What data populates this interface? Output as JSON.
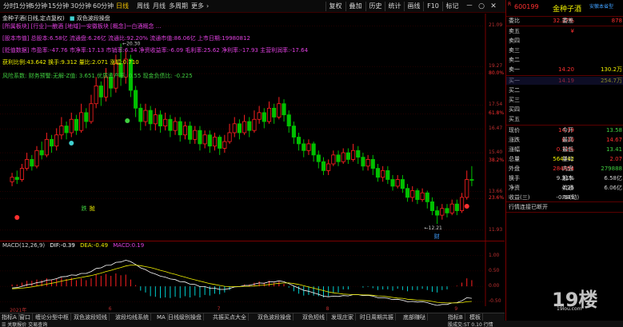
{
  "toolbar": {
    "periods": [
      "分时",
      "1分钟",
      "5分钟",
      "15分钟",
      "30分钟",
      "60分钟",
      "日线",
      "周线",
      "月线",
      "多周期",
      "更多"
    ],
    "active_period": "日线",
    "more_arrow": "›",
    "buttons": [
      "复权",
      "叠加",
      "历史",
      "统计",
      "画线",
      "F10",
      "标记"
    ],
    "window_controls": [
      "－",
      "○",
      "✕"
    ]
  },
  "main_chart": {
    "title": "金种子酒(日线,定点复权)",
    "indicator_name": "双色波段操盘",
    "info_lines": [
      {
        "text": "[所属板块]  [行业]一酿酒  [地域]一安徽板块  [概念]一白酒概念  ...",
        "color": "#e040e0"
      },
      {
        "text": "[股本市值]  总股本:6.58亿  流通盘:6.26亿  流通比:92.20%  流通市值:86.06亿  上市日期:19980812",
        "color": "#e040e0"
      },
      {
        "text": "[贬值数据]  市盈率:-47.76  市净率:17.13  市销率:6.34  净资收益率:-6.09  毛利率:25.62  净利率:-17.93  主营利润率:-17.64",
        "color": "#e040e0"
      },
      {
        "text": "获利比例:43.642    换手:9.312      量比:2.071      涨幅:0.710",
        "color": "#f0f000"
      },
      {
        "text": "风险系数: 财务预警:无解-Z值: 3.651  优质资产率: 0.55  现金负债比: -0.225",
        "color": "#40d040"
      }
    ],
    "high_label": "20.30",
    "low_label": "12.21",
    "bottom_badge_left": "跌",
    "bottom_badge_right": "抛",
    "low_badge": "财",
    "price_ticks": [
      {
        "label": "21.09",
        "price": 21.09
      },
      {
        "label": "19.27",
        "price": 19.27
      },
      {
        "label": "80.0%",
        "price": 18.95
      },
      {
        "label": "17.54",
        "price": 17.54
      },
      {
        "label": "61.8%",
        "price": 17.15
      },
      {
        "label": "16.47",
        "price": 16.47
      },
      {
        "label": "15.40",
        "price": 15.4
      },
      {
        "label": "38.2%",
        "price": 15.05
      },
      {
        "label": "13.66",
        "price": 13.66
      },
      {
        "label": "23.6%",
        "price": 13.35
      },
      {
        "label": "11.93",
        "price": 11.93
      }
    ],
    "price_range": [
      11.6,
      21.5
    ]
  },
  "candles": [
    [
      14.1,
      14.3,
      14.5,
      13.9
    ],
    [
      14.3,
      14.2,
      14.6,
      14.0
    ],
    [
      14.2,
      14.7,
      14.9,
      14.1
    ],
    [
      14.7,
      15.1,
      15.4,
      14.6
    ],
    [
      15.1,
      14.8,
      15.3,
      14.6
    ],
    [
      14.8,
      15.5,
      15.7,
      14.7
    ],
    [
      15.5,
      15.3,
      15.9,
      15.1
    ],
    [
      15.3,
      16.0,
      16.3,
      15.2
    ],
    [
      16.0,
      15.7,
      16.2,
      15.4
    ],
    [
      15.7,
      16.2,
      16.5,
      15.5
    ],
    [
      16.2,
      16.6,
      17.0,
      16.0
    ],
    [
      16.6,
      16.3,
      16.8,
      16.0
    ],
    [
      16.3,
      16.9,
      17.2,
      16.1
    ],
    [
      16.9,
      16.4,
      17.1,
      16.2
    ],
    [
      16.4,
      17.2,
      17.6,
      16.3
    ],
    [
      17.2,
      16.8,
      17.4,
      16.5
    ],
    [
      16.8,
      17.6,
      18.0,
      16.7
    ],
    [
      17.6,
      18.4,
      18.8,
      17.4
    ],
    [
      18.4,
      17.9,
      18.6,
      17.5
    ],
    [
      17.9,
      18.8,
      19.2,
      17.7
    ],
    [
      18.8,
      18.3,
      19.0,
      17.9
    ],
    [
      18.3,
      19.4,
      19.8,
      18.1
    ],
    [
      19.4,
      18.8,
      20.3,
      18.4
    ],
    [
      18.8,
      19.6,
      20.0,
      18.5
    ],
    [
      19.6,
      18.2,
      19.8,
      17.9
    ],
    [
      18.2,
      17.4,
      18.4,
      17.0
    ],
    [
      17.4,
      16.8,
      17.6,
      16.4
    ],
    [
      16.8,
      17.3,
      17.6,
      16.6
    ],
    [
      17.3,
      16.7,
      17.5,
      16.4
    ],
    [
      16.7,
      17.1,
      17.4,
      16.4
    ],
    [
      17.1,
      16.6,
      17.3,
      16.3
    ],
    [
      16.6,
      16.9,
      17.2,
      16.4
    ],
    [
      16.9,
      16.4,
      17.1,
      16.1
    ],
    [
      16.4,
      16.8,
      17.0,
      16.2
    ],
    [
      16.8,
      16.2,
      17.0,
      15.9
    ],
    [
      16.2,
      16.6,
      16.8,
      16.0
    ],
    [
      16.6,
      16.0,
      16.8,
      15.8
    ],
    [
      16.0,
      16.4,
      16.6,
      15.8
    ],
    [
      16.4,
      15.8,
      16.6,
      15.5
    ],
    [
      15.8,
      16.2,
      16.4,
      15.6
    ],
    [
      16.2,
      15.7,
      16.4,
      15.4
    ],
    [
      15.7,
      16.1,
      16.3,
      15.5
    ],
    [
      16.1,
      15.6,
      16.2,
      15.3
    ],
    [
      15.6,
      15.9,
      16.2,
      15.4
    ],
    [
      15.9,
      16.3,
      16.7,
      15.8
    ],
    [
      16.3,
      16.7,
      17.0,
      16.1
    ],
    [
      16.7,
      16.3,
      16.9,
      16.0
    ],
    [
      16.3,
      16.8,
      17.1,
      16.2
    ],
    [
      16.8,
      16.4,
      17.0,
      16.1
    ],
    [
      16.4,
      16.9,
      17.3,
      16.3
    ],
    [
      16.9,
      17.2,
      17.5,
      16.7
    ],
    [
      17.2,
      16.8,
      17.4,
      16.5
    ],
    [
      16.8,
      17.4,
      17.7,
      16.7
    ],
    [
      17.4,
      17.0,
      17.6,
      16.7
    ],
    [
      17.0,
      17.6,
      17.9,
      16.9
    ],
    [
      17.6,
      17.1,
      17.8,
      16.8
    ],
    [
      17.1,
      16.6,
      17.3,
      16.3
    ],
    [
      16.6,
      16.1,
      16.8,
      15.8
    ],
    [
      16.1,
      15.8,
      16.3,
      15.5
    ],
    [
      15.8,
      15.5,
      16.0,
      15.2
    ],
    [
      15.5,
      15.8,
      16.0,
      15.3
    ],
    [
      15.8,
      15.3,
      15.9,
      15.0
    ],
    [
      15.3,
      15.0,
      15.5,
      14.7
    ],
    [
      15.0,
      14.6,
      15.2,
      14.4
    ],
    [
      14.6,
      14.9,
      15.1,
      14.4
    ],
    [
      14.9,
      15.3,
      15.5,
      14.8
    ],
    [
      15.3,
      15.0,
      15.5,
      14.8
    ],
    [
      15.0,
      15.4,
      15.6,
      14.9
    ],
    [
      15.4,
      15.1,
      15.6,
      14.9
    ],
    [
      15.1,
      15.5,
      15.8,
      15.0
    ],
    [
      15.5,
      15.2,
      15.7,
      14.9
    ],
    [
      15.2,
      14.8,
      15.4,
      14.6
    ],
    [
      14.8,
      15.1,
      15.3,
      14.6
    ],
    [
      15.1,
      14.7,
      15.3,
      14.4
    ],
    [
      14.7,
      14.3,
      14.9,
      14.1
    ],
    [
      14.3,
      14.6,
      14.8,
      14.1
    ],
    [
      14.6,
      14.2,
      14.8,
      14.0
    ],
    [
      14.2,
      13.9,
      14.4,
      13.7
    ],
    [
      13.9,
      14.2,
      14.4,
      13.8
    ],
    [
      14.2,
      13.8,
      14.4,
      13.6
    ],
    [
      13.8,
      13.4,
      14.0,
      13.2
    ],
    [
      13.4,
      13.7,
      13.9,
      13.2
    ],
    [
      13.7,
      13.3,
      13.8,
      13.1
    ],
    [
      13.3,
      13.6,
      13.8,
      13.2
    ],
    [
      13.6,
      13.2,
      13.7,
      12.9
    ],
    [
      13.2,
      12.8,
      13.4,
      12.6
    ],
    [
      12.8,
      12.6,
      13.0,
      12.21
    ],
    [
      12.6,
      12.9,
      13.1,
      12.4
    ],
    [
      12.9,
      12.7,
      13.1,
      12.5
    ],
    [
      12.7,
      13.1,
      13.3,
      12.6
    ],
    [
      13.1,
      12.8,
      13.3,
      12.6
    ],
    [
      12.8,
      13.4,
      13.6,
      12.7
    ],
    [
      13.4,
      14.2,
      14.6,
      13.3
    ],
    [
      14.2,
      14.19,
      14.8,
      13.9
    ]
  ],
  "macd": {
    "label": "MACD(12,26,9)",
    "dif": "-0.39",
    "dea": "-0.49",
    "macd": "0.19",
    "dif_prefix": "DIF:",
    "dea_prefix": "DEA:",
    "macd_prefix": "MACD:",
    "range": [
      -0.62,
      1.25
    ],
    "ticks": [
      {
        "label": "1.00",
        "v": 1.0
      },
      {
        "label": "0.50",
        "v": 0.5
      },
      {
        "label": "0.00",
        "v": 0.0
      },
      {
        "label": "-0.50",
        "v": -0.5
      }
    ],
    "dif_series": [
      -0.05,
      -0.04,
      0.0,
      0.05,
      0.07,
      0.12,
      0.14,
      0.2,
      0.21,
      0.25,
      0.31,
      0.32,
      0.37,
      0.36,
      0.42,
      0.42,
      0.48,
      0.58,
      0.6,
      0.68,
      0.69,
      0.78,
      0.79,
      0.85,
      0.8,
      0.71,
      0.6,
      0.54,
      0.45,
      0.4,
      0.33,
      0.3,
      0.24,
      0.22,
      0.15,
      0.14,
      0.07,
      0.06,
      -0.01,
      -0.01,
      -0.06,
      -0.06,
      -0.1,
      -0.1,
      -0.07,
      -0.02,
      -0.01,
      0.03,
      0.03,
      0.07,
      0.11,
      0.1,
      0.15,
      0.14,
      0.18,
      0.15,
      0.09,
      0.01,
      -0.06,
      -0.13,
      -0.16,
      -0.21,
      -0.26,
      -0.32,
      -0.34,
      -0.32,
      -0.33,
      -0.3,
      -0.31,
      -0.27,
      -0.27,
      -0.3,
      -0.29,
      -0.32,
      -0.37,
      -0.37,
      -0.39,
      -0.43,
      -0.42,
      -0.45,
      -0.5,
      -0.49,
      -0.51,
      -0.5,
      -0.53,
      -0.58,
      -0.62,
      -0.59,
      -0.59,
      -0.54,
      -0.53,
      -0.47,
      -0.37,
      -0.39
    ],
    "dea_series": [
      -0.08,
      -0.07,
      -0.06,
      -0.04,
      -0.02,
      0.01,
      0.04,
      0.07,
      0.1,
      0.13,
      0.17,
      0.2,
      0.23,
      0.26,
      0.29,
      0.32,
      0.35,
      0.39,
      0.43,
      0.48,
      0.52,
      0.57,
      0.61,
      0.66,
      0.69,
      0.69,
      0.67,
      0.64,
      0.61,
      0.57,
      0.52,
      0.48,
      0.43,
      0.39,
      0.34,
      0.3,
      0.25,
      0.21,
      0.17,
      0.13,
      0.09,
      0.06,
      0.03,
      0.0,
      -0.01,
      -0.01,
      -0.01,
      0.0,
      0.0,
      0.01,
      0.03,
      0.04,
      0.06,
      0.08,
      0.1,
      0.11,
      0.11,
      0.09,
      0.06,
      0.02,
      -0.02,
      -0.06,
      -0.1,
      -0.14,
      -0.18,
      -0.21,
      -0.23,
      -0.25,
      -0.26,
      -0.27,
      -0.27,
      -0.28,
      -0.28,
      -0.29,
      -0.31,
      -0.32,
      -0.34,
      -0.36,
      -0.38,
      -0.39,
      -0.42,
      -0.43,
      -0.45,
      -0.46,
      -0.47,
      -0.49,
      -0.52,
      -0.53,
      -0.54,
      -0.54,
      -0.54,
      -0.53,
      -0.5,
      -0.49
    ]
  },
  "dates": [
    {
      "label": "2021年",
      "idx": 0
    },
    {
      "label": "6",
      "idx": 20
    },
    {
      "label": "7",
      "idx": 42
    },
    {
      "label": "8",
      "idx": 64
    },
    {
      "label": "9",
      "idx": 90
    }
  ],
  "tabs": [
    "指标A",
    "窗口",
    "缠论分型中枢",
    "双色波段短线",
    "波段均线系统",
    "MA",
    "日线级别操盘",
    "共振买点大全",
    "双色波段操盘",
    "双色短线",
    "发现庄家",
    "时日周期共振",
    "底部赚哒"
  ],
  "tabs_right": [
    "指标B",
    "模板"
  ],
  "status": {
    "left": "☰  关联报价     交易查询",
    "right": "股成交:ST 0.10 行情"
  },
  "right_panel": {
    "r_tag": "R",
    "code": "600199",
    "name": "金种子酒",
    "tag": "安徽本省型",
    "weibi_label": "委比",
    "weibi_value": "32.37%",
    "weicha_label": "委差",
    "weicha_value": "878",
    "sell_rows": [
      {
        "label": "卖五",
        "price": "¥",
        "vol": ""
      },
      {
        "label": "卖四",
        "price": "",
        "vol": ""
      },
      {
        "label": "卖三",
        "price": "",
        "vol": ""
      },
      {
        "label": "卖二",
        "price": "",
        "vol": ""
      },
      {
        "label": "卖一",
        "price": "14.20",
        "vol": "130.2万"
      }
    ],
    "buy_rows": [
      {
        "label": "买一",
        "price": "14.19",
        "vol": "254.7万"
      },
      {
        "label": "买二",
        "price": "",
        "vol": ""
      },
      {
        "label": "买三",
        "price": "",
        "vol": ""
      },
      {
        "label": "买四",
        "price": "",
        "vol": ""
      },
      {
        "label": "买五",
        "price": "",
        "vol": ""
      }
    ],
    "stats": [
      {
        "l1": "现价",
        "v1": "14.19",
        "c1": "#ff3030",
        "l2": "今开",
        "v2": "13.58",
        "c2": "#40d040"
      },
      {
        "l1": "涨跌",
        "v1": "0.10",
        "c1": "#ff3030",
        "l2": "最高",
        "v2": "14.67",
        "c2": "#ff3030"
      },
      {
        "l1": "涨幅",
        "v1": "0.71%",
        "c1": "#ff3030",
        "l2": "最低",
        "v2": "13.41",
        "c2": "#40d040"
      },
      {
        "l1": "总量",
        "v1": "564742",
        "c1": "#f0f000",
        "l2": "量比",
        "v2": "2.07",
        "c2": "#ff3030"
      },
      {
        "l1": "外盘",
        "v1": "284854",
        "c1": "#ff3030",
        "l2": "内盘",
        "v2": "279888",
        "c2": "#40d040"
      },
      {
        "l1": "换手",
        "v1": "9.31%",
        "c1": "#d0d0d0",
        "l2": "股本",
        "v2": "6.58亿",
        "c2": "#d0d0d0"
      },
      {
        "l1": "净资",
        "v1": "4.25",
        "c1": "#d0d0d0",
        "l2": "流通",
        "v2": "6.06亿",
        "c2": "#d0d0d0"
      },
      {
        "l1": "收益(三)",
        "v1": "-0.149",
        "c1": "#d0d0d0",
        "l2": "PE(动)",
        "v2": "",
        "c2": "#d0d0d0"
      }
    ],
    "connection": "行情连接已断开"
  },
  "watermark": {
    "text": "19楼",
    "sub": "19lou.com"
  },
  "colors": {
    "up": "#ff2020",
    "down": "#00c000",
    "dif": "#ffffff",
    "dea": "#f0f000"
  }
}
